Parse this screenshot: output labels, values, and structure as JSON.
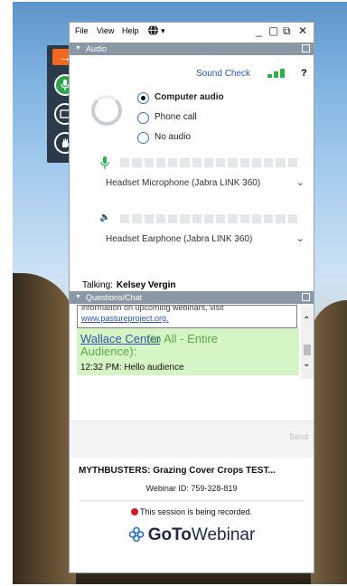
{
  "menubar": {
    "file": "File",
    "view": "View",
    "help": "Help",
    "globe_icon": "globe-icon",
    "caret": "▾"
  },
  "window_controls": {
    "minimize": "_",
    "restore": "▢",
    "popout": "⧉",
    "close": "✕"
  },
  "audio_section": {
    "title": "Audio",
    "sound_check": "Sound Check",
    "help": "?",
    "options": [
      {
        "label": "Computer audio",
        "selected": true
      },
      {
        "label": "Phone call",
        "selected": false
      },
      {
        "label": "No audio",
        "selected": false
      }
    ],
    "microphone": "Headset Microphone (Jabra LINK 360)",
    "speaker": "Headset Earphone (Jabra LINK 360)",
    "talking_label": "Talking:",
    "talking_name": "Kelsey Vergin"
  },
  "chat_section": {
    "title": "Questions/Chat",
    "previous_line": "information on upcoming webinars, visit",
    "previous_link": "www.pastureproject.org.",
    "message_sender": "Wallace Center",
    "message_to_1": "(to All - Entire",
    "message_to_2": "Audience):",
    "message_text": "12:32 PM: Hello audience",
    "send_label": "Send"
  },
  "webinar": {
    "title": "MYTHBUSTERS: Grazing Cover Crops TEST...",
    "id": "Webinar ID: 759-328-819",
    "recording": "This session is being recorded.",
    "brand_1": "GoTo",
    "brand_2": "Webinar"
  },
  "colors": {
    "section_header": "#8a98a6",
    "accent_blue": "#2a55b0",
    "green": "#2bb14a",
    "orange": "#ef6a20",
    "record_red": "#cf1e22",
    "chat_highlight": "#d6f5c4"
  }
}
